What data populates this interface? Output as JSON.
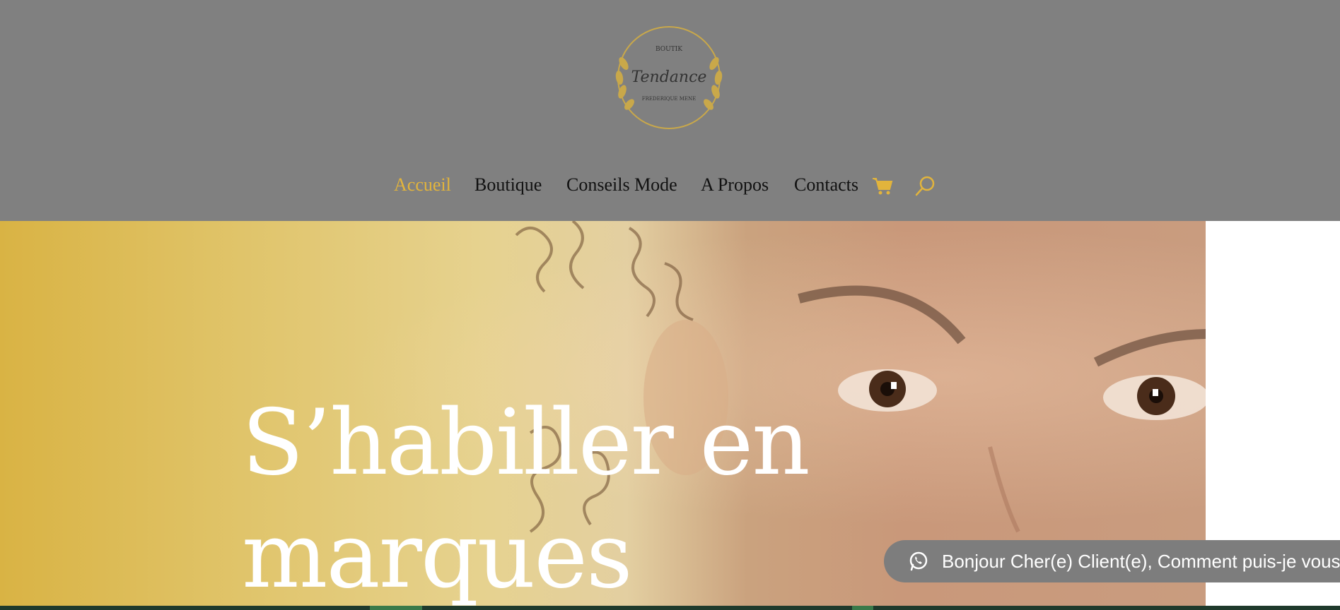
{
  "logo": {
    "top_text": "BOUTIK",
    "script_text": "Tendance",
    "bottom_text": "FREDERIQUE MENE"
  },
  "nav": {
    "items": [
      {
        "label": "Accueil",
        "active": true
      },
      {
        "label": "Boutique",
        "active": false
      },
      {
        "label": "Conseils Mode",
        "active": false
      },
      {
        "label": "A Propos",
        "active": false
      },
      {
        "label": "Contacts",
        "active": false
      }
    ],
    "cart_icon": "cart-icon",
    "search_icon": "search-icon"
  },
  "hero": {
    "title_line1": "S’habiller en",
    "title_line2": "marques"
  },
  "chat": {
    "icon": "whatsapp-icon",
    "text": "Bonjour Cher(e) Client(e), Comment puis-je vous aider ?"
  },
  "colors": {
    "header_bg": "#808080",
    "accent_gold": "#e2b43c",
    "nav_text": "#111111",
    "chat_bg": "#7d7d7d"
  }
}
